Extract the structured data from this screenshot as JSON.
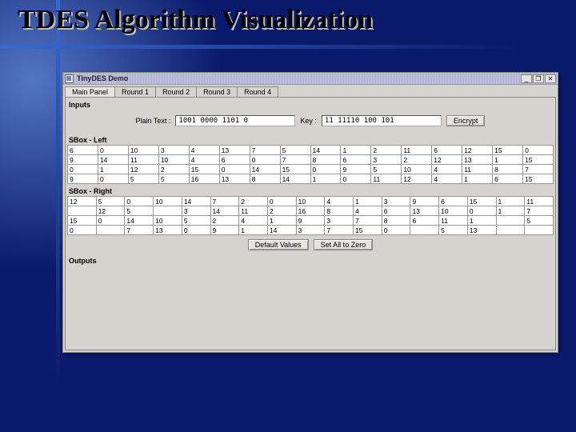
{
  "slide": {
    "title": "TDES Algorithm Visualization"
  },
  "window": {
    "title": "TinyDES Demo",
    "controls": {
      "min": "_",
      "max": "❐",
      "close": "✕"
    }
  },
  "tabs": [
    "Main Panel",
    "Round 1",
    "Round 2",
    "Round 3",
    "Round 4"
  ],
  "active_tab": 0,
  "groups": {
    "inputs": "Inputs",
    "sbox_left": "SBox - Left",
    "sbox_right": "SBox - Right",
    "outputs": "Outputs"
  },
  "inputs": {
    "plaintext_label": "Plain Text :",
    "plaintext_value": "1001  0000  1101  0",
    "key_label": "Key :",
    "key_value": "11  11110  100  101",
    "encrypt_label": "Encrypt"
  },
  "sbox_left": [
    [
      "6",
      "0",
      "10",
      "3",
      "4",
      "13",
      "7",
      "5",
      "14",
      "1",
      "2",
      "11",
      "6",
      "12",
      "15",
      "0"
    ],
    [
      "9",
      "14",
      "11",
      "10",
      "4",
      "6",
      "0",
      "7",
      "8",
      "6",
      "3",
      "2",
      "12",
      "13",
      "1",
      "15"
    ],
    [
      "0",
      "1",
      "12",
      "2",
      "15",
      "0",
      "14",
      "15",
      "0",
      "9",
      "5",
      "10",
      "4",
      "11",
      "8",
      "7"
    ],
    [
      "9",
      "0",
      "5",
      "5",
      "16",
      "13",
      "8",
      "14",
      "1",
      "0",
      "11",
      "12",
      "4",
      "1",
      "6",
      "15"
    ]
  ],
  "sbox_right": [
    [
      "12",
      "5",
      "0",
      "10",
      "14",
      "7",
      "2",
      "0",
      "10",
      "4",
      "1",
      "3",
      "9",
      "6",
      "15",
      "1",
      "11"
    ],
    [
      "",
      "12",
      "5",
      "",
      "3",
      "14",
      "11",
      "2",
      "16",
      "8",
      "4",
      "6",
      "13",
      "10",
      "0",
      "1",
      "7"
    ],
    [
      "15",
      "0",
      "14",
      "10",
      "5",
      "2",
      "4",
      "1",
      "9",
      "3",
      "7",
      "8",
      "6",
      "11",
      "1",
      "",
      "5"
    ],
    [
      "0",
      "",
      "7",
      "13",
      "0",
      "9",
      "1",
      "14",
      "3",
      "7",
      "15",
      "0",
      "",
      "5",
      "13",
      "",
      ""
    ]
  ],
  "buttons": {
    "default_values": "Default Values",
    "set_zero": "Set All to Zero"
  }
}
